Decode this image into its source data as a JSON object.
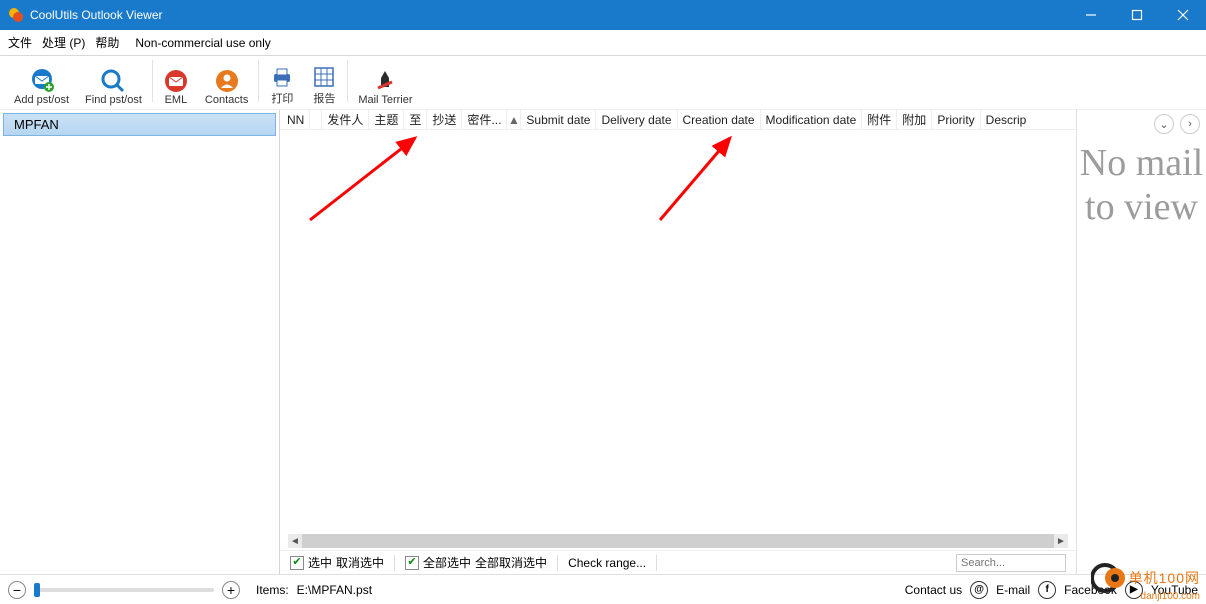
{
  "window": {
    "title": "CoolUtils Outlook Viewer"
  },
  "menu": {
    "file": "文件",
    "process": "处理 (P)",
    "help": "帮助",
    "license": "Non-commercial use only"
  },
  "toolbar": {
    "add_pst": "Add pst/ost",
    "find_pst": "Find pst/ost",
    "eml": "EML",
    "contacts": "Contacts",
    "print": "打印",
    "report": "报告",
    "mail_terrier": "Mail Terrier"
  },
  "sidebar": {
    "folder": "MPFAN"
  },
  "columns": {
    "nn": "NN",
    "sender": "发件人",
    "subject": "主题",
    "to": "至",
    "cc": "抄送",
    "bcc": "密件...",
    "submit": "Submit date",
    "delivery": "Delivery date",
    "creation": "Creation date",
    "modification": "Modification date",
    "attach1": "附件",
    "attach2": "附加",
    "priority": "Priority",
    "descrip": "Descrip"
  },
  "selection": {
    "select": "选中",
    "deselect": "取消选中",
    "select_all": "全部选中",
    "deselect_all": "全部取消选中",
    "check_range": "Check range..."
  },
  "search": {
    "placeholder": "Search..."
  },
  "preview": {
    "no_mail": "No mail to view"
  },
  "status": {
    "items_label": "Items:",
    "path": "E:\\MPFAN.pst",
    "contact": "Contact us",
    "email": "E-mail",
    "facebook": "Facebook",
    "youtube": "YouTube"
  },
  "watermark": {
    "text": "单机100网",
    "url": "danji100.com"
  }
}
